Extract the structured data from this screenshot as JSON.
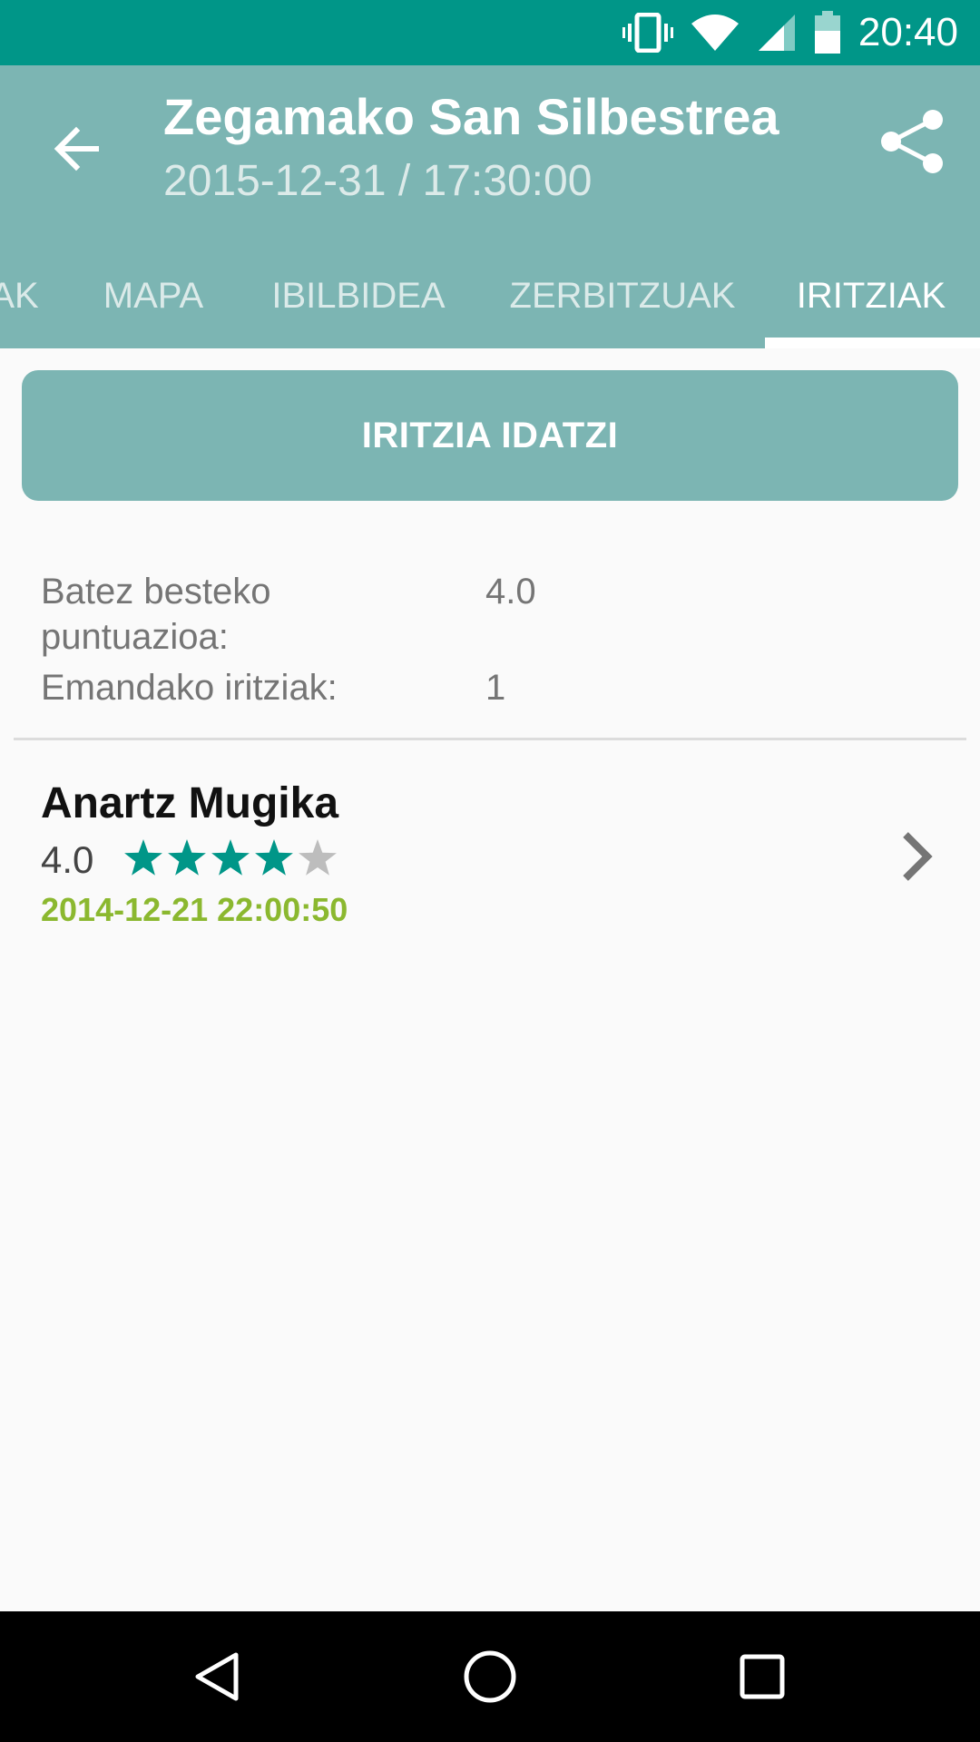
{
  "status_bar": {
    "time": "20:40",
    "icons": [
      "vibrate-icon",
      "wifi-icon",
      "cell-signal-icon",
      "battery-icon"
    ]
  },
  "app_bar": {
    "title": "Zegamako San Silbestrea",
    "subtitle": "2015-12-31 / 17:30:00",
    "back_icon": "arrow-back-icon",
    "share_icon": "share-icon"
  },
  "tabs": [
    {
      "label": "AK",
      "active": false
    },
    {
      "label": "MAPA",
      "active": false
    },
    {
      "label": "IBILBIDEA",
      "active": false
    },
    {
      "label": "ZERBITZUAK",
      "active": false
    },
    {
      "label": "IRITZIAK",
      "active": true
    }
  ],
  "write_button": {
    "label": "IRITZIA IDATZI"
  },
  "stats": {
    "average_label": "Batez besteko puntuazioa:",
    "average_value": "4.0",
    "count_label": "Emandako iritziak:",
    "count_value": "1"
  },
  "reviews": [
    {
      "author": "Anartz Mugika",
      "score": "4.0",
      "rating": 4,
      "max_rating": 5,
      "date": "2014-12-21 22:00:50"
    }
  ],
  "colors": {
    "status_bar": "#009688",
    "app_bar": "#7cb5b3",
    "star_filled": "#009688",
    "star_empty": "#bdbdbd",
    "date": "#8bb82f"
  },
  "nav_bar": {
    "icons": [
      "back-triangle-icon",
      "home-circle-icon",
      "recents-square-icon"
    ]
  }
}
